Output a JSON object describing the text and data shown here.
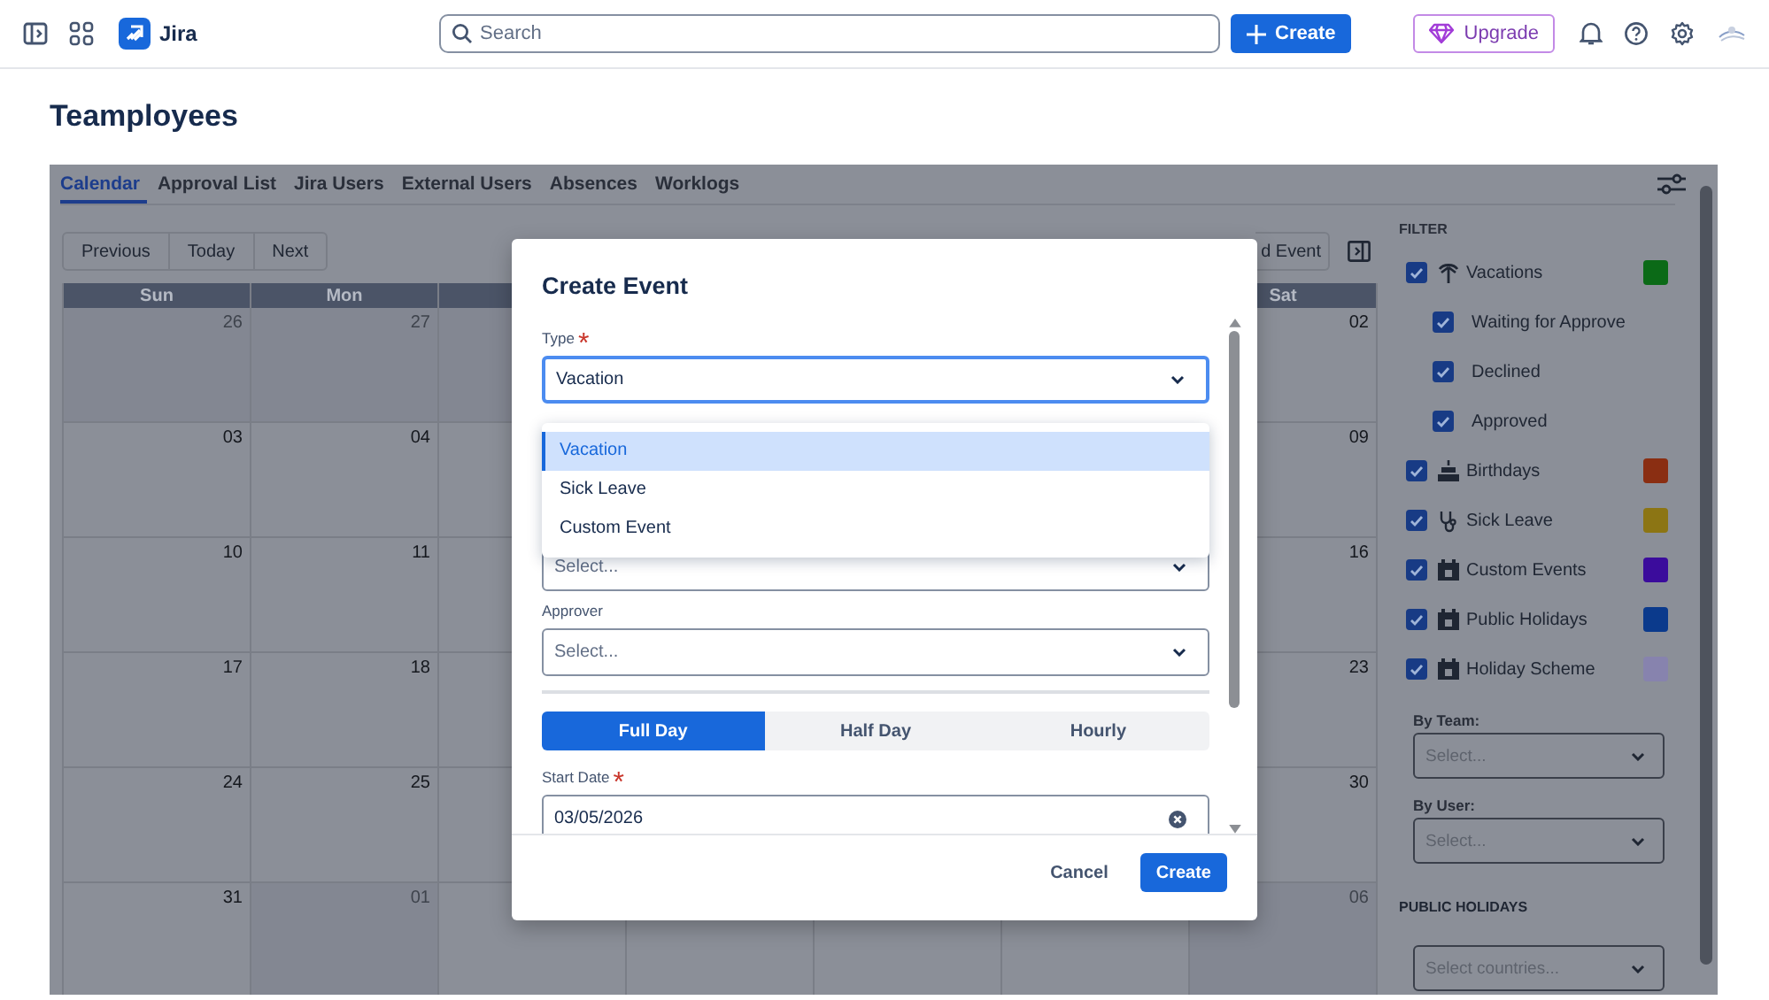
{
  "topbar": {
    "app_name": "Jira",
    "search": {
      "placeholder": "Search"
    },
    "create_label": "Create",
    "upgrade_label": "Upgrade"
  },
  "page_title": "Teamployees",
  "tabs": [
    {
      "label": "Calendar",
      "selected": true
    },
    {
      "label": "Approval List",
      "selected": false
    },
    {
      "label": "Jira Users",
      "selected": false
    },
    {
      "label": "External Users",
      "selected": false
    },
    {
      "label": "Absences",
      "selected": false
    },
    {
      "label": "Worklogs",
      "selected": false
    }
  ],
  "calendar": {
    "nav_buttons": [
      "Previous",
      "Today",
      "Next"
    ],
    "add_event_label": "d Event",
    "headers": {
      "sun": "Sun",
      "mon": "Mon",
      "sat": "Sat"
    },
    "weeks": [
      {
        "sun": {
          "date": "26",
          "outside_month": true
        },
        "mon": {
          "date": "27",
          "outside_month": true
        },
        "sat": {
          "date": "02",
          "outside_month": false
        }
      },
      {
        "sun": {
          "date": "03",
          "outside_month": false
        },
        "mon": {
          "date": "04",
          "outside_month": false
        },
        "sat": {
          "date": "09",
          "outside_month": false
        }
      },
      {
        "sun": {
          "date": "10",
          "outside_month": false
        },
        "mon": {
          "date": "11",
          "outside_month": false
        },
        "sat": {
          "date": "16",
          "outside_month": false
        }
      },
      {
        "sun": {
          "date": "17",
          "outside_month": false
        },
        "mon": {
          "date": "18",
          "outside_month": false
        },
        "sat": {
          "date": "23",
          "outside_month": false
        }
      },
      {
        "sun": {
          "date": "24",
          "outside_month": false
        },
        "mon": {
          "date": "25",
          "outside_month": false
        },
        "sat": {
          "date": "30",
          "outside_month": false
        }
      },
      {
        "sun": {
          "date": "31",
          "outside_month": false
        },
        "mon": {
          "date": "01",
          "outside_month": true
        },
        "sat": {
          "date": "06",
          "outside_month": true
        }
      }
    ]
  },
  "filter": {
    "heading": "FILTER",
    "items": [
      {
        "label": "Vacations",
        "checked": true,
        "color": "#0b6a17",
        "children": [
          {
            "label": "Waiting for Approve",
            "checked": true
          },
          {
            "label": "Declined",
            "checked": true
          },
          {
            "label": "Approved",
            "checked": true
          }
        ]
      },
      {
        "label": "Birthdays",
        "checked": true,
        "color": "#8a2e12"
      },
      {
        "label": "Sick Leave",
        "checked": true,
        "color": "#8c7514"
      },
      {
        "label": "Custom Events",
        "checked": true,
        "color": "#3b0c9c"
      },
      {
        "label": "Public Holidays",
        "checked": true,
        "color": "#0b3a8c"
      },
      {
        "label": "Holiday Scheme",
        "checked": true,
        "color": "#8783ae"
      }
    ],
    "by_team": {
      "label": "By Team:",
      "placeholder": "Select..."
    },
    "by_user": {
      "label": "By User:",
      "placeholder": "Select..."
    },
    "public_holidays": {
      "heading": "PUBLIC HOLIDAYS",
      "placeholder": "Select countries..."
    }
  },
  "modal": {
    "title": "Create Event",
    "type": {
      "label": "Type",
      "required_mark": "*",
      "value": "Vacation",
      "options": [
        {
          "label": "Vacation",
          "selected": true
        },
        {
          "label": "Sick Leave",
          "selected": false
        },
        {
          "label": "Custom Event",
          "selected": false
        }
      ]
    },
    "hidden_field": {
      "placeholder": "Select..."
    },
    "approver": {
      "label": "Approver",
      "placeholder": "Select..."
    },
    "duration": [
      {
        "label": "Full Day",
        "selected": true
      },
      {
        "label": "Half Day",
        "selected": false
      },
      {
        "label": "Hourly",
        "selected": false
      }
    ],
    "start_date": {
      "label": "Start Date",
      "required_mark": "*",
      "value": "03/05/2026"
    },
    "cancel_label": "Cancel",
    "create_label": "Create"
  }
}
